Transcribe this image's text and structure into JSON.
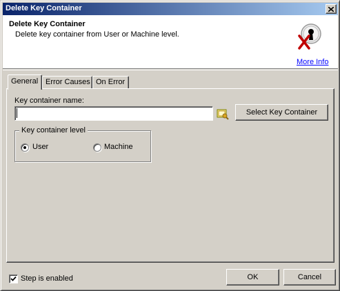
{
  "window": {
    "title": "Delete Key Container"
  },
  "header": {
    "title": "Delete Key Container",
    "description": "Delete key container from User or Machine level.",
    "more_info": "More Info",
    "icon": "key-delete-icon"
  },
  "tabs": [
    {
      "label": "General",
      "active": true
    },
    {
      "label": "Error Causes",
      "active": false
    },
    {
      "label": "On Error",
      "active": false
    }
  ],
  "general": {
    "container_name_label": "Key container name:",
    "container_name_value": "",
    "select_button": "Select Key Container",
    "level_group_label": "Key container level",
    "level_options": [
      {
        "label": "User",
        "checked": true
      },
      {
        "label": "Machine",
        "checked": false
      }
    ]
  },
  "footer": {
    "step_enabled_label": "Step is enabled",
    "step_enabled_checked": true,
    "ok_label": "OK",
    "cancel_label": "Cancel"
  },
  "colors": {
    "title_start": "#0a246a",
    "title_end": "#a6caf0",
    "face": "#d4d0c8",
    "link": "#0000ff"
  }
}
